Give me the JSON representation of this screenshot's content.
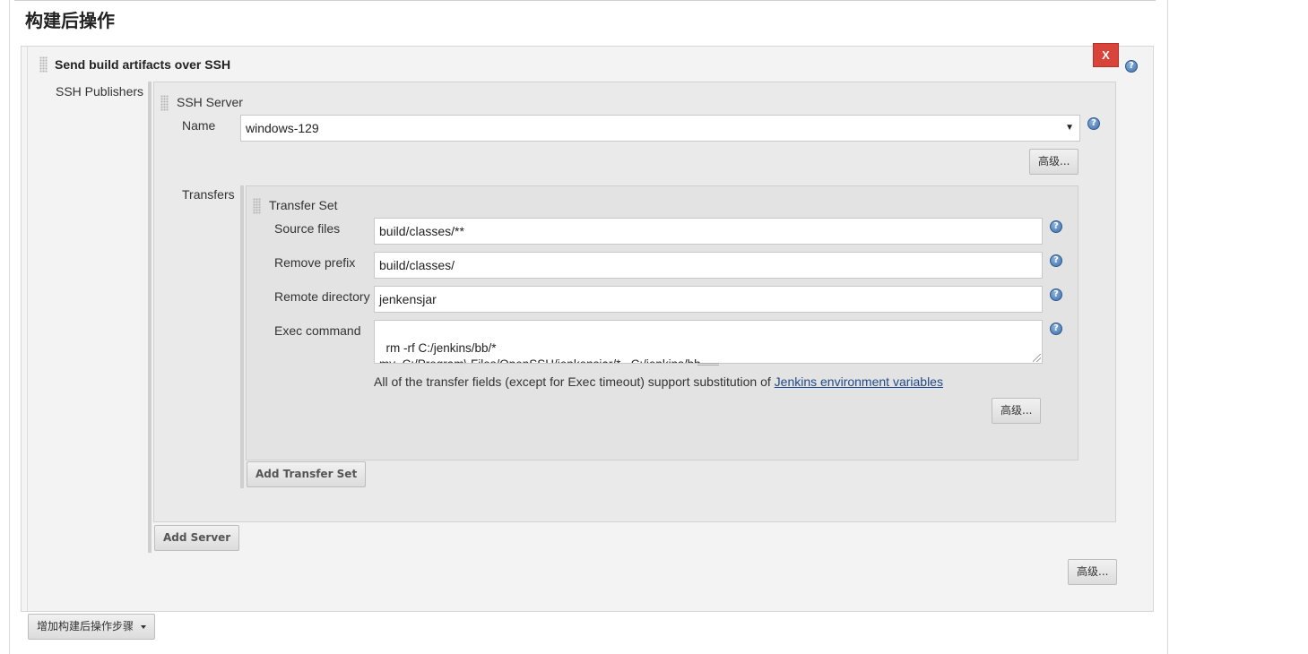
{
  "section_title": "构建后操作",
  "publisher": {
    "title": "Send build artifacts over SSH",
    "delete_label": "X",
    "ssh_publishers_label": "SSH Publishers",
    "server": {
      "title": "SSH Server",
      "name_label": "Name",
      "name_value": "windows-129",
      "advanced_label": "高级...",
      "transfers_label": "Transfers",
      "transfer_set": {
        "title": "Transfer Set",
        "source_files_label": "Source files",
        "source_files_value": "build/classes/**",
        "remove_prefix_label": "Remove prefix",
        "remove_prefix_value": "build/classes/",
        "remote_directory_label": "Remote directory",
        "remote_directory_value": "jenkensjar",
        "exec_command_label": "Exec command",
        "exec_command_value": "rm -rf C:/jenkins/bb/*\nmv  C:/Program\\ Files/OpenSSH/jenkensjar/*   C:/jenkins/bb",
        "note_text": "All of the transfer fields (except for Exec timeout) support substitution of ",
        "note_link": "Jenkins environment variables",
        "advanced_label": "高级..."
      },
      "add_transfer_set_label": "Add Transfer Set"
    },
    "add_server_label": "Add Server",
    "advanced_label": "高级..."
  },
  "add_post_build_step_label": "增加构建后操作步骤",
  "help_glyph": "?"
}
